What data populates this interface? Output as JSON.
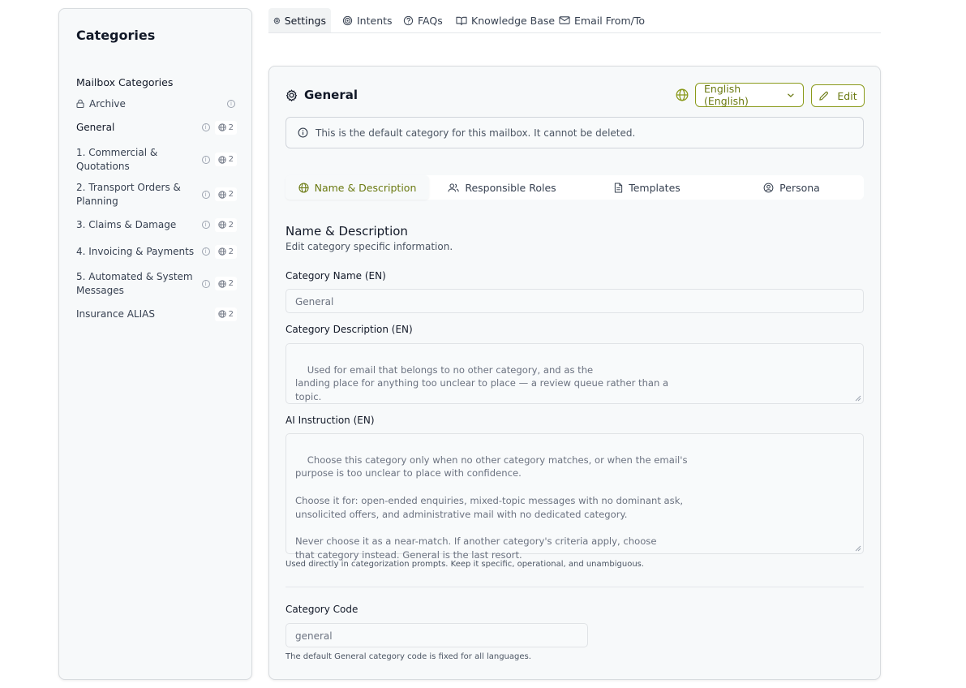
{
  "sidebar": {
    "title": "Categories",
    "section_label": "Mailbox Categories",
    "items": [
      {
        "label": "Archive",
        "lang_count": ""
      },
      {
        "label": "General",
        "lang_count": "2"
      },
      {
        "label": "1. Commercial & Quotations",
        "lang_count": "2"
      },
      {
        "label": "2. Transport Orders & Planning",
        "lang_count": "2"
      },
      {
        "label": "3. Claims & Damage",
        "lang_count": "2"
      },
      {
        "label": "4. Invoicing & Payments",
        "lang_count": "2"
      },
      {
        "label": "5. Automated & System Messages",
        "lang_count": "2"
      },
      {
        "label": "Insurance ALIAS",
        "lang_count": "2"
      }
    ]
  },
  "topnav": {
    "tabs": [
      {
        "label": "Settings",
        "icon": "gear-icon"
      },
      {
        "label": "Intents",
        "icon": "target-icon"
      },
      {
        "label": "FAQs",
        "icon": "question-circle-icon"
      },
      {
        "label": "Knowledge Base",
        "icon": "book-open-icon"
      },
      {
        "label": "Email From/To",
        "icon": "mail-icon"
      }
    ]
  },
  "card": {
    "title": "General",
    "language_select": "English (English)",
    "edit_label": "Edit",
    "notice": "This is the default category for this mailbox. It cannot be deleted.",
    "subtabs": [
      {
        "label": "Name & Description",
        "icon": "globe-icon"
      },
      {
        "label": "Responsible Roles",
        "icon": "users-icon"
      },
      {
        "label": "Templates",
        "icon": "document-icon"
      },
      {
        "label": "Persona",
        "icon": "user-circle-icon"
      }
    ],
    "section_title": "Name & Description",
    "section_subtitle": "Edit category specific information.",
    "name_label": "Category Name (EN)",
    "name_value": "General",
    "description_label": "Category Description (EN)",
    "description_value": "Used for email that belongs to no other category, and as the\nlanding place for anything too unclear to place — a review queue rather than a\ntopic.",
    "ai_label": "AI Instruction (EN)",
    "ai_value": "Choose this category only when no other category matches, or when the email's\npurpose is too unclear to place with confidence.\n\nChoose it for: open-ended enquiries, mixed-topic messages with no dominant ask,\nunsolicited offers, and administrative mail with no dedicated category.\n\nNever choose it as a near-match. If another category's criteria apply, choose\nthat category instead. General is the last resort.",
    "ai_help": "Used directly in categorization prompts. Keep it specific, operational, and unambiguous.",
    "code_label": "Category Code",
    "code_value": "general",
    "code_help": "The default General category code is fixed for all languages."
  },
  "colors": {
    "accent": "#6b7a12",
    "accent_border": "#8a9a1b",
    "panel_bg": "#f7f9fa"
  }
}
